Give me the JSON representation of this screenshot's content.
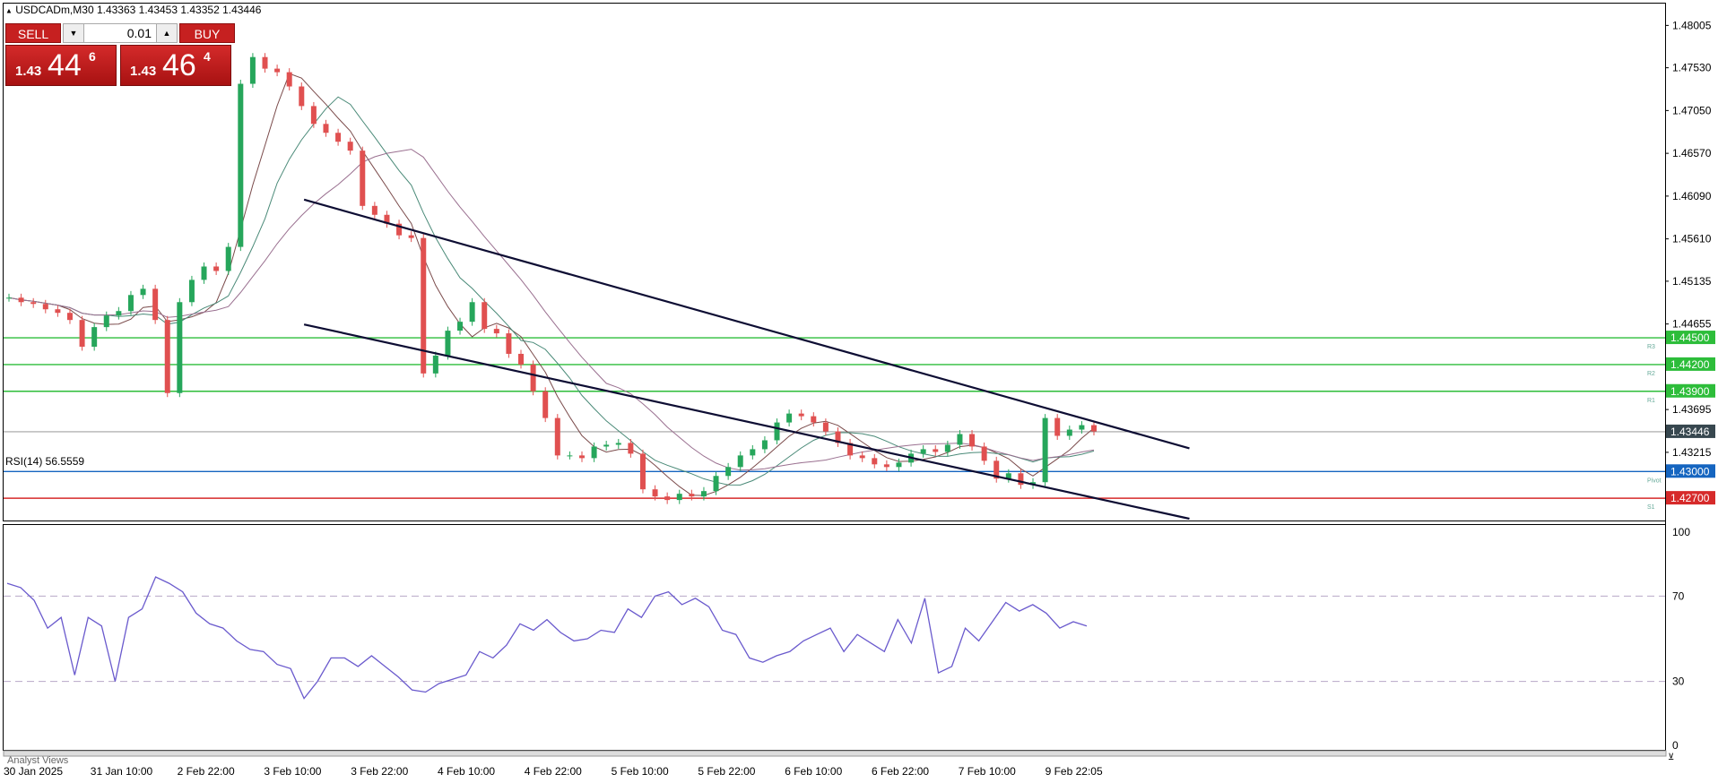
{
  "header": {
    "collapse_icon": "triangle-up-icon",
    "symbol_text": "USDCADm,M30  1.43363 1.43453 1.43352 1.43446"
  },
  "trade_panel": {
    "sell_label": "SELL",
    "buy_label": "BUY",
    "lot_value": "0.01",
    "decrease_icon": "triangle-down-icon",
    "increase_icon": "triangle-up-icon",
    "sell_price": {
      "prefix": "1.43",
      "big": "44",
      "sup": "6"
    },
    "buy_price": {
      "prefix": "1.43",
      "big": "46",
      "sup": "4"
    }
  },
  "price_axis": {
    "labels": [
      "1.48005",
      "1.47530",
      "1.47050",
      "1.46570",
      "1.46090",
      "1.45610",
      "1.45135",
      "1.44655",
      "1.43695",
      "1.43215"
    ]
  },
  "levels": [
    {
      "value": 1.445,
      "label": "1.44500",
      "marker": "R3",
      "color": "#2dbd3a"
    },
    {
      "value": 1.442,
      "label": "1.44200",
      "marker": "R2",
      "color": "#2dbd3a"
    },
    {
      "value": 1.439,
      "label": "1.43900",
      "marker": "R1",
      "color": "#2dbd3a"
    },
    {
      "value": 1.43,
      "label": "1.43000",
      "marker": "Pivot",
      "color": "#1565c0"
    },
    {
      "value": 1.427,
      "label": "1.42700",
      "marker": "S1",
      "color": "#d62a2a"
    }
  ],
  "bid_line": {
    "value": 1.43446,
    "label": "1.43446",
    "color": "#37474f"
  },
  "rsi": {
    "label": "RSI(14) 56.5559",
    "axis_labels": [
      "100",
      "70",
      "30",
      "0"
    ],
    "levels": [
      70,
      30
    ],
    "color": "#6a5acd"
  },
  "time_axis": {
    "labels": [
      "30 Jan 2025",
      "31 Jan 10:00",
      "2 Feb 22:00",
      "3 Feb 10:00",
      "3 Feb 22:00",
      "4 Feb 10:00",
      "4 Feb 22:00",
      "5 Feb 10:00",
      "5 Feb 22:00",
      "6 Feb 10:00",
      "6 Feb 22:00",
      "7 Feb 10:00",
      "9 Feb 22:05"
    ]
  },
  "bottom_panel": {
    "label": "Analyst Views"
  },
  "chart_data": {
    "type": "candlestick",
    "title": "USDCADm,M30",
    "y_range": [
      1.4245,
      1.4825
    ],
    "close_series": [
      1.4495,
      1.449,
      1.4488,
      1.4482,
      1.4478,
      1.447,
      1.444,
      1.4462,
      1.4475,
      1.448,
      1.4498,
      1.4505,
      1.447,
      1.4388,
      1.449,
      1.4515,
      1.453,
      1.4525,
      1.4552,
      1.4735,
      1.4765,
      1.4752,
      1.4748,
      1.4732,
      1.471,
      1.469,
      1.468,
      1.467,
      1.466,
      1.4598,
      1.4588,
      1.4578,
      1.4565,
      1.4562,
      1.441,
      1.443,
      1.4458,
      1.4468,
      1.449,
      1.446,
      1.4455,
      1.4432,
      1.442,
      1.439,
      1.436,
      1.4318,
      1.4318,
      1.4315,
      1.4328,
      1.433,
      1.4332,
      1.432,
      1.428,
      1.4272,
      1.4268,
      1.4275,
      1.4272,
      1.4278,
      1.4295,
      1.4305,
      1.4318,
      1.4325,
      1.4335,
      1.4355,
      1.4365,
      1.4362,
      1.4355,
      1.4345,
      1.4332,
      1.4318,
      1.4315,
      1.4308,
      1.4305,
      1.431,
      1.432,
      1.4325,
      1.4322,
      1.433,
      1.4342,
      1.4328,
      1.4312,
      1.4292,
      1.4298,
      1.4285,
      1.4288,
      1.436,
      1.434,
      1.4347,
      1.4352,
      1.4345
    ],
    "rsi_series": [
      76,
      74,
      68,
      55,
      60,
      33,
      60,
      56,
      30,
      60,
      64,
      79,
      76,
      72,
      62,
      57,
      55,
      49,
      45,
      44,
      38,
      36,
      22,
      30,
      41,
      41,
      37,
      42,
      37,
      32,
      26,
      25,
      29,
      31,
      33,
      44,
      41,
      47,
      57,
      54,
      59,
      53,
      49,
      50,
      54,
      53,
      64,
      60,
      70,
      72,
      66,
      69,
      65,
      54,
      52,
      41,
      39,
      42,
      44,
      49,
      52,
      55,
      44,
      52,
      48,
      44,
      59,
      48,
      69,
      34,
      37,
      55,
      49,
      58,
      67,
      63,
      66,
      62,
      55,
      58,
      56
    ],
    "trendlines": [
      {
        "from": [
          3.4,
          1.4605
        ],
        "to": [
          13.6,
          1.4326
        ]
      },
      {
        "from": [
          3.4,
          1.4465
        ],
        "to": [
          13.6,
          1.4247
        ]
      }
    ],
    "moving_averages": [
      {
        "name": "MA1",
        "color": "#7a4a4a"
      },
      {
        "name": "MA2",
        "color": "#4a8a78"
      },
      {
        "name": "MA3",
        "color": "#9a7090"
      }
    ],
    "grid": false,
    "legend": "none"
  }
}
